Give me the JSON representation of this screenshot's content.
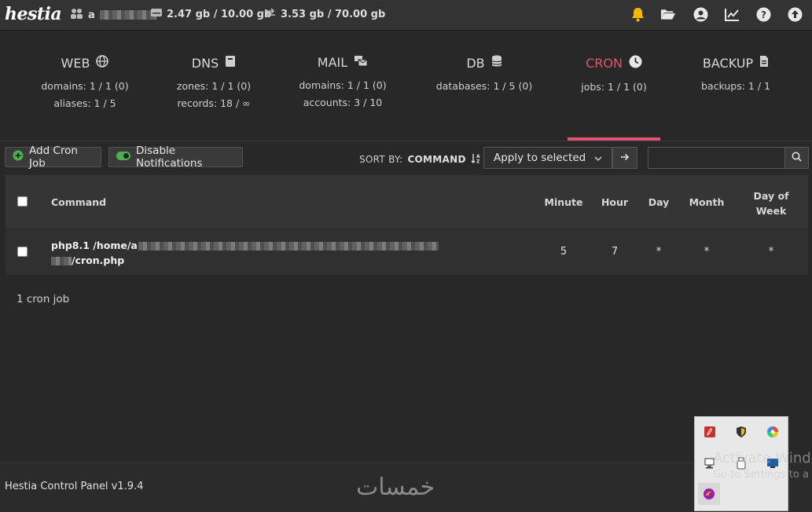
{
  "app": {
    "logo": "hestia"
  },
  "topbar": {
    "user": "a",
    "disk": "2.47 gb / 10.00 gb",
    "bandwidth": "3.53 gb / 70.00 gb",
    "icons": [
      "bell-icon",
      "folder-open-icon",
      "user-circle-icon",
      "chart-line-icon",
      "help-icon",
      "upload-icon"
    ],
    "bell_color": "#f5b700"
  },
  "tabs": [
    {
      "title": "WEB",
      "icon": "globe-icon",
      "line1": "domains: 1 / 1 (0)",
      "line2": "aliases: 1 / 5"
    },
    {
      "title": "DNS",
      "icon": "book-icon",
      "line1": "zones: 1 / 1 (0)",
      "line2": "records: 18 / ∞"
    },
    {
      "title": "MAIL",
      "icon": "mail-bulk-icon",
      "line1": "domains: 1 / 1 (0)",
      "line2": "accounts: 3 / 10"
    },
    {
      "title": "DB",
      "icon": "database-icon",
      "line1": "databases: 1 / 5 (0)",
      "line2": ""
    },
    {
      "title": "CRON",
      "icon": "clock-icon",
      "line1": "jobs: 1 / 1 (0)",
      "line2": "",
      "active": true
    },
    {
      "title": "BACKUP",
      "icon": "file-icon",
      "line1": "backups: 1 / 1",
      "line2": ""
    }
  ],
  "accent": "#e4516e",
  "toolbar": {
    "add_label": "Add Cron Job",
    "disable_label": "Disable Notifications",
    "sort_by_label": "SORT BY:",
    "sort_value": "COMMAND",
    "bulk_select": "Apply to selected",
    "search_placeholder": ""
  },
  "table": {
    "headers": {
      "command": "Command",
      "minute": "Minute",
      "hour": "Hour",
      "day": "Day",
      "month": "Month",
      "dow1": "Day of",
      "dow2": "Week"
    },
    "rows": [
      {
        "command_line1": "php8.1 /home/a",
        "command_line2": "/cron.php",
        "minute": "5",
        "hour": "7",
        "day": "*",
        "month": "*",
        "dow": "*"
      }
    ]
  },
  "summary": "1 cron job",
  "footer": {
    "text": "Hestia Control Panel v1.9.4",
    "watermark": "خمسات"
  },
  "overlay": {
    "activate_line1": "Activate Windo",
    "activate_line2": "Go to Settings to a"
  }
}
